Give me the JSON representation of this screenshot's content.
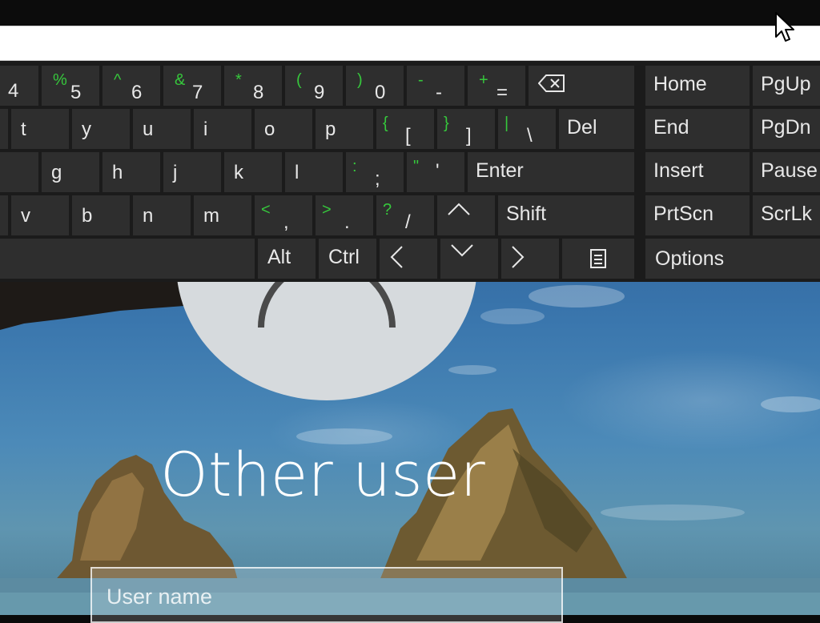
{
  "keyboard": {
    "keys": [
      {
        "id": "key-4",
        "main": "4"
      },
      {
        "id": "key-5",
        "shift": "%",
        "main": "5"
      },
      {
        "id": "key-6",
        "shift": "^",
        "main": "6"
      },
      {
        "id": "key-7",
        "shift": "&",
        "main": "7"
      },
      {
        "id": "key-8",
        "shift": "*",
        "main": "8"
      },
      {
        "id": "key-9",
        "shift": "(",
        "main": "9"
      },
      {
        "id": "key-0",
        "shift": ")",
        "main": "0"
      },
      {
        "id": "key-minus",
        "shift": "-",
        "main": "-"
      },
      {
        "id": "key-equals",
        "shift": "+",
        "main": "="
      },
      {
        "id": "key-t",
        "main": "t"
      },
      {
        "id": "key-y",
        "main": "y"
      },
      {
        "id": "key-u",
        "main": "u"
      },
      {
        "id": "key-i",
        "main": "i"
      },
      {
        "id": "key-o",
        "main": "o"
      },
      {
        "id": "key-p",
        "main": "p"
      },
      {
        "id": "key-open-bracket",
        "shift": "{",
        "main": "["
      },
      {
        "id": "key-close-bracket",
        "shift": "}",
        "main": "]"
      },
      {
        "id": "key-backslash",
        "shift": "|",
        "main": "\\"
      },
      {
        "id": "key-g",
        "main": "g"
      },
      {
        "id": "key-h",
        "main": "h"
      },
      {
        "id": "key-j",
        "main": "j"
      },
      {
        "id": "key-k",
        "main": "k"
      },
      {
        "id": "key-l",
        "main": "l"
      },
      {
        "id": "key-semicolon",
        "shift": ":",
        "main": ";"
      },
      {
        "id": "key-quote",
        "shift": "\"",
        "main": "'"
      },
      {
        "id": "key-v",
        "main": "v"
      },
      {
        "id": "key-b",
        "main": "b"
      },
      {
        "id": "key-n",
        "main": "n"
      },
      {
        "id": "key-m",
        "main": "m"
      },
      {
        "id": "key-comma",
        "shift": "<",
        "main": ","
      },
      {
        "id": "key-period",
        "shift": ">",
        "main": "."
      },
      {
        "id": "key-slash",
        "shift": "?",
        "main": "/"
      }
    ],
    "commands": {
      "del": "Del",
      "enter": "Enter",
      "shift": "Shift",
      "alt": "Alt",
      "ctrl": "Ctrl",
      "home": "Home",
      "pgup": "PgUp",
      "end": "End",
      "pgdn": "PgDn",
      "insert": "Insert",
      "pause": "Pause",
      "prtscn": "PrtScn",
      "scrlk": "ScrLk",
      "options": "Options"
    },
    "icons": {
      "backspace": "backspace-icon",
      "arrow_up": "arrow-up-icon",
      "arrow_down": "arrow-down-icon",
      "arrow_left": "arrow-left-icon",
      "arrow_right": "arrow-right-icon",
      "menu": "menu-key-icon"
    },
    "colors": {
      "key_bg": "#2e2e2e",
      "key_text": "#e8e8e8",
      "shift_char": "#36c83c",
      "panel_bg": "#1b1b1b"
    }
  },
  "login": {
    "user_title": "Other user",
    "username_placeholder": "User name"
  }
}
